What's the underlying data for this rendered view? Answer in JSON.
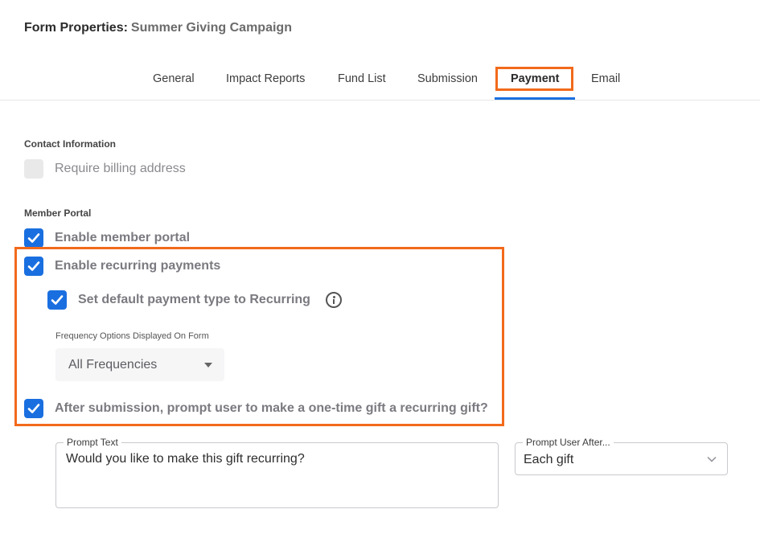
{
  "header": {
    "title_prefix": "Form Properties:",
    "campaign_name": "Summer Giving Campaign"
  },
  "tabs": [
    {
      "label": "General",
      "active": false
    },
    {
      "label": "Impact Reports",
      "active": false
    },
    {
      "label": "Fund List",
      "active": false
    },
    {
      "label": "Submission",
      "active": false
    },
    {
      "label": "Payment",
      "active": true
    },
    {
      "label": "Email",
      "active": false
    }
  ],
  "contact": {
    "section_label": "Contact Information",
    "require_billing": {
      "label": "Require billing address",
      "checked": false,
      "disabled": true
    }
  },
  "member_portal": {
    "section_label": "Member Portal",
    "enable_portal": {
      "label": "Enable member portal",
      "checked": true
    },
    "enable_recurring": {
      "label": "Enable recurring payments",
      "checked": true
    },
    "default_recurring": {
      "label": "Set default payment type to Recurring",
      "checked": true
    },
    "frequency": {
      "label": "Frequency Options Displayed On Form",
      "value": "All Frequencies"
    },
    "prompt_recurring": {
      "label": "After submission, prompt user to make a one-time gift a recurring gift?",
      "checked": true
    }
  },
  "prompt": {
    "text_label": "Prompt Text",
    "text_value": "Would you like to make this gift recurring?",
    "after_label": "Prompt User After...",
    "after_value": "Each gift"
  },
  "colors": {
    "accent": "#1a6fe0",
    "highlight": "#f26a1b"
  }
}
